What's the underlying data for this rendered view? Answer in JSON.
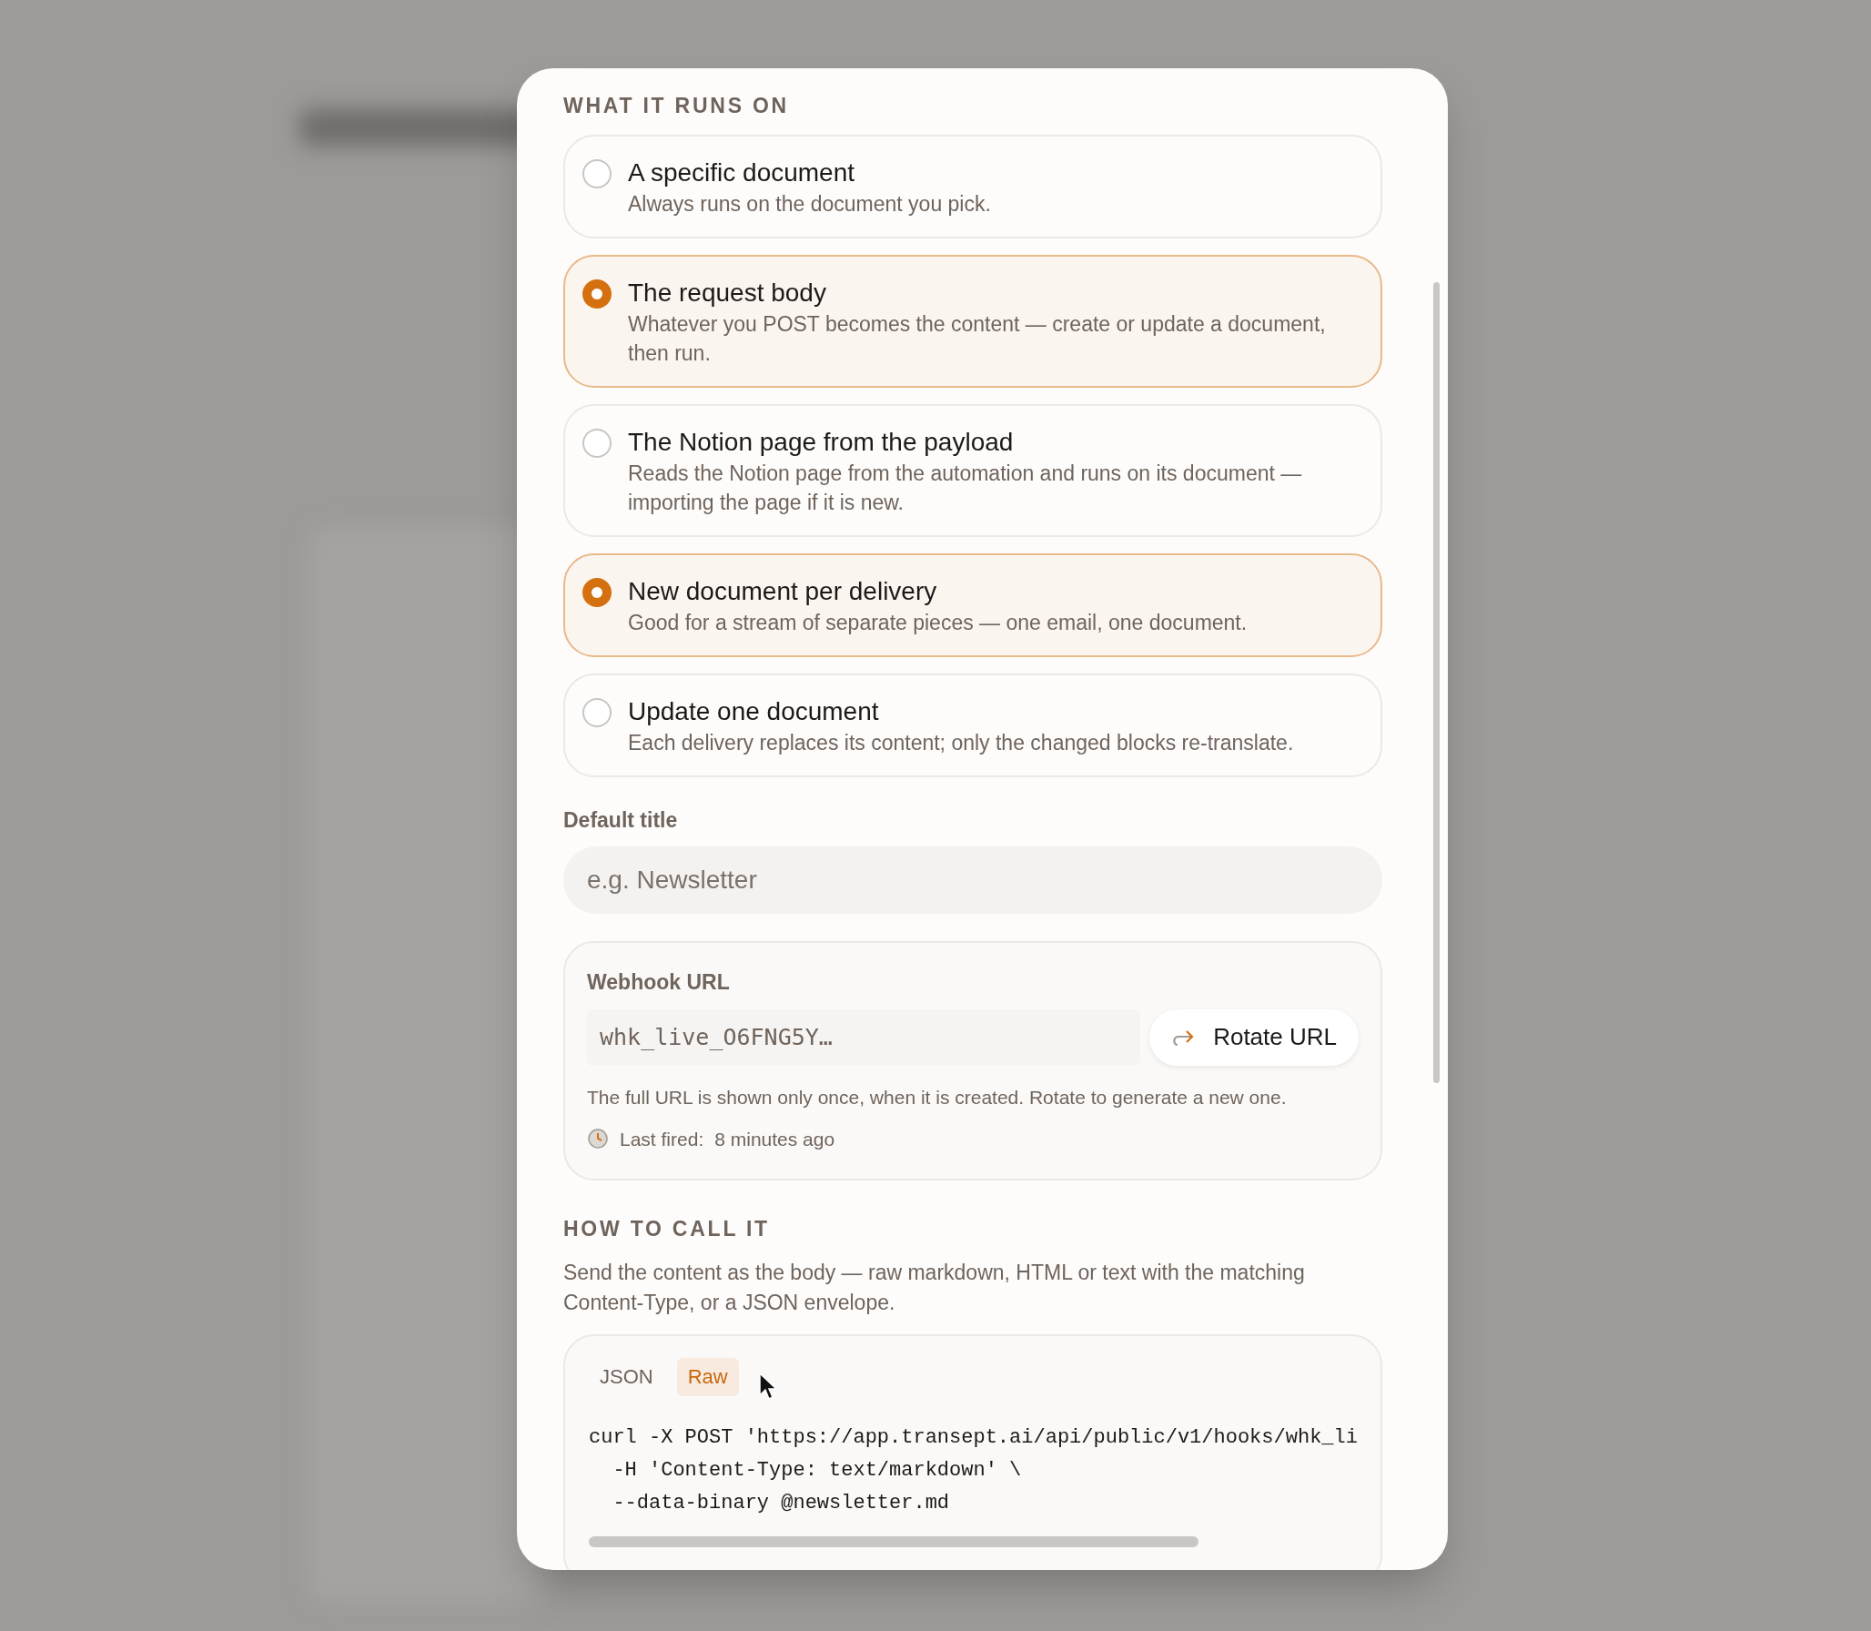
{
  "section_title": "WHAT IT RUNS ON",
  "options": [
    {
      "title": "A specific document",
      "description": "Always runs on the document you pick.",
      "selected": false
    },
    {
      "title": "The request body",
      "description": "Whatever you POST becomes the content — create or update a document, then run.",
      "selected": true
    },
    {
      "title": "The Notion page from the payload",
      "description": "Reads the Notion page from the automation and runs on its document — importing the page if it is new.",
      "selected": false
    },
    {
      "title": "New document per delivery",
      "description": "Good for a stream of separate pieces — one email, one document.",
      "selected": true
    },
    {
      "title": "Update one document",
      "description": "Each delivery replaces its content; only the changed blocks re-translate.",
      "selected": false
    }
  ],
  "default_title": {
    "label": "Default title",
    "placeholder": "e.g. Newsletter"
  },
  "webhook": {
    "label": "Webhook URL",
    "value": "whk_live_O6FNG5Y…",
    "button": "Rotate URL",
    "note": "The full URL is shown only once, when it is created. Rotate to generate a new one.",
    "last_fired_label": "Last fired:",
    "last_fired_value": "8 minutes ago"
  },
  "how_to_call": {
    "title": "HOW TO CALL IT",
    "description": "Send the content as the body — raw markdown, HTML or text with the matching Content-Type, or a JSON envelope.",
    "tabs": [
      {
        "label": "JSON",
        "selected": false
      },
      {
        "label": "Raw",
        "selected": true
      }
    ],
    "code": [
      "curl -X POST 'https://app.transept.ai/api/public/v1/hooks/whk_li",
      "  -H 'Content-Type: text/markdown' \\",
      "  --data-binary @newsletter.md"
    ]
  }
}
